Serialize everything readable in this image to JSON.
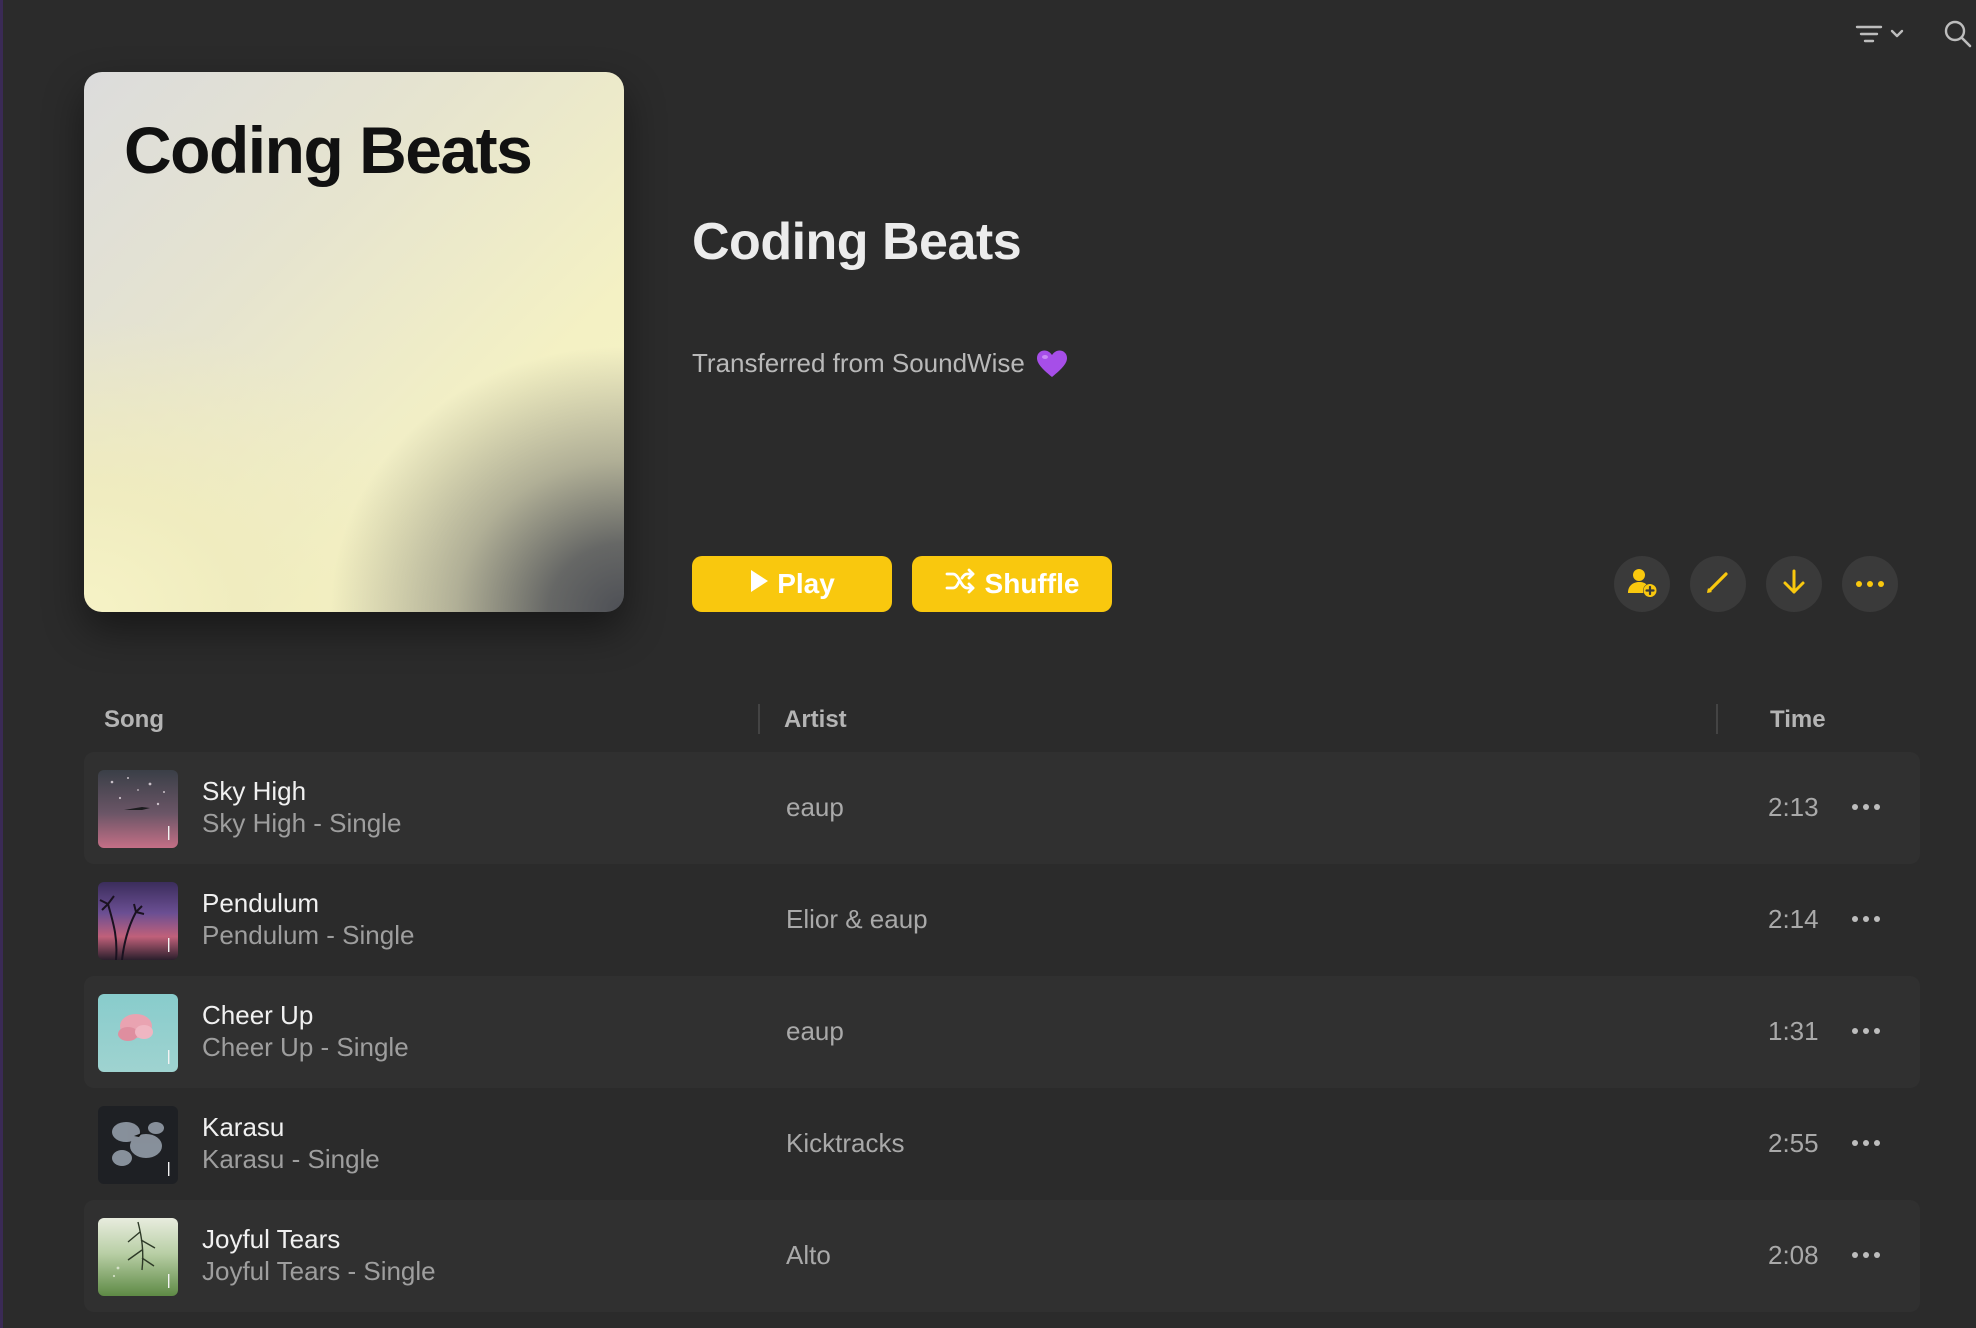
{
  "toolbar": {
    "sort_icon": "list-filter-icon",
    "search_icon": "search-icon"
  },
  "playlist": {
    "artwork_title": "Coding Beats",
    "title": "Coding Beats",
    "description": "Transferred from SoundWise",
    "description_emoji": "purple-heart",
    "play_label": "Play",
    "shuffle_label": "Shuffle",
    "accent_color": "#f9c80e",
    "actions": [
      "add-collaborator-icon",
      "edit-pencil-icon",
      "download-arrow-icon",
      "more-ellipsis-icon"
    ]
  },
  "table": {
    "headers": {
      "song": "Song",
      "artist": "Artist",
      "time": "Time"
    },
    "rows": [
      {
        "title": "Sky High",
        "album": "Sky High - Single",
        "artist": "eaup",
        "time": "2:13"
      },
      {
        "title": "Pendulum",
        "album": "Pendulum - Single",
        "artist": "Elior & eaup",
        "time": "2:14"
      },
      {
        "title": "Cheer Up",
        "album": "Cheer Up - Single",
        "artist": "eaup",
        "time": "1:31"
      },
      {
        "title": "Karasu",
        "album": "Karasu - Single",
        "artist": "Kicktracks",
        "time": "2:55"
      },
      {
        "title": "Joyful Tears",
        "album": "Joyful Tears - Single",
        "artist": "Alto",
        "time": "2:08"
      }
    ]
  }
}
